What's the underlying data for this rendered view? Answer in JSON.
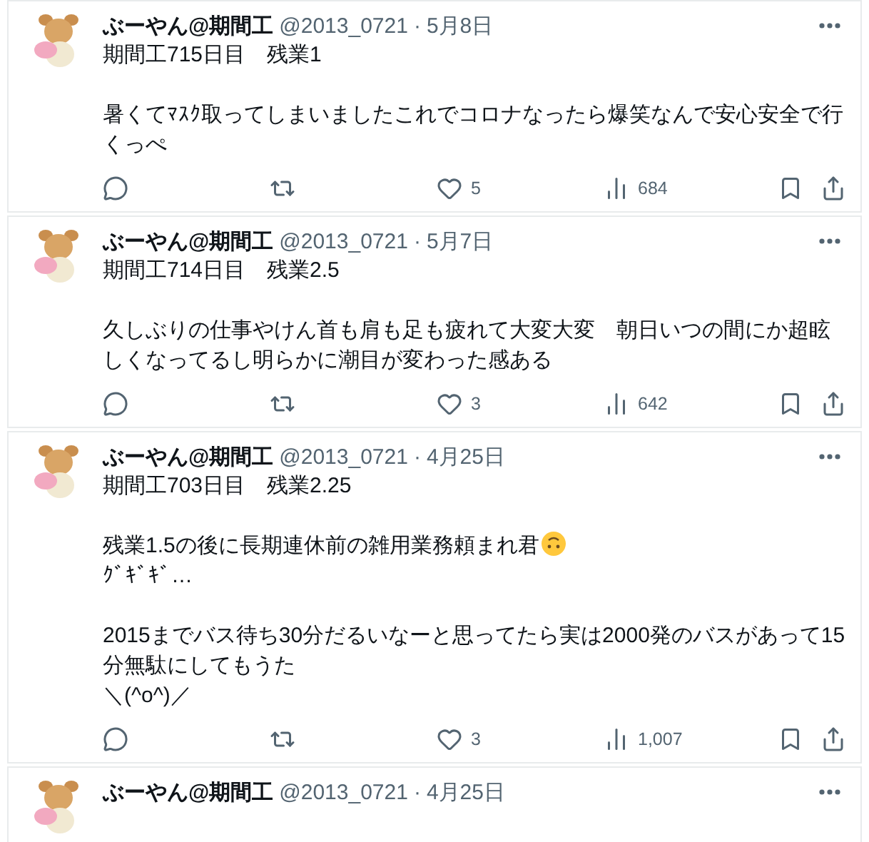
{
  "separator": "·",
  "tweets": [
    {
      "name": "ぶーやん@期間工",
      "handle": "@2013_0721",
      "date": "5月8日",
      "lines": [
        {
          "kind": "text",
          "text": "期間工715日目　残業1"
        },
        {
          "kind": "blank"
        },
        {
          "kind": "text",
          "text": "暑くてﾏｽｸ取ってしまいましたこれでコロナなったら爆笑なんで安心安全で行くっぺ"
        }
      ],
      "likes": "5",
      "views": "684"
    },
    {
      "name": "ぶーやん@期間工",
      "handle": "@2013_0721",
      "date": "5月7日",
      "lines": [
        {
          "kind": "text",
          "text": "期間工714日目　残業2.5"
        },
        {
          "kind": "blank"
        },
        {
          "kind": "text",
          "text": "久しぶりの仕事やけん首も肩も足も疲れて大変大変　朝日いつの間にか超眩しくなってるし明らかに潮目が変わった感ある"
        }
      ],
      "likes": "3",
      "views": "642"
    },
    {
      "name": "ぶーやん@期間工",
      "handle": "@2013_0721",
      "date": "4月25日",
      "lines": [
        {
          "kind": "text",
          "text": "期間工703日目　残業2.25"
        },
        {
          "kind": "blank"
        },
        {
          "kind": "emoji",
          "text": "残業1.5の後に長期連休前の雑用業務頼まれ君"
        },
        {
          "kind": "text",
          "text": "ｸﾞｷﾞｷﾞ…"
        },
        {
          "kind": "blank"
        },
        {
          "kind": "text",
          "text": "2015までバス待ち30分だるいなーと思ってたら実は2000発のバスがあって15分無駄にしてもうた"
        },
        {
          "kind": "text",
          "text": "＼(^o^)／"
        }
      ],
      "likes": "3",
      "views": "1,007"
    },
    {
      "name": "ぶーやん@期間工",
      "handle": "@2013_0721",
      "date": "4月25日"
    }
  ]
}
